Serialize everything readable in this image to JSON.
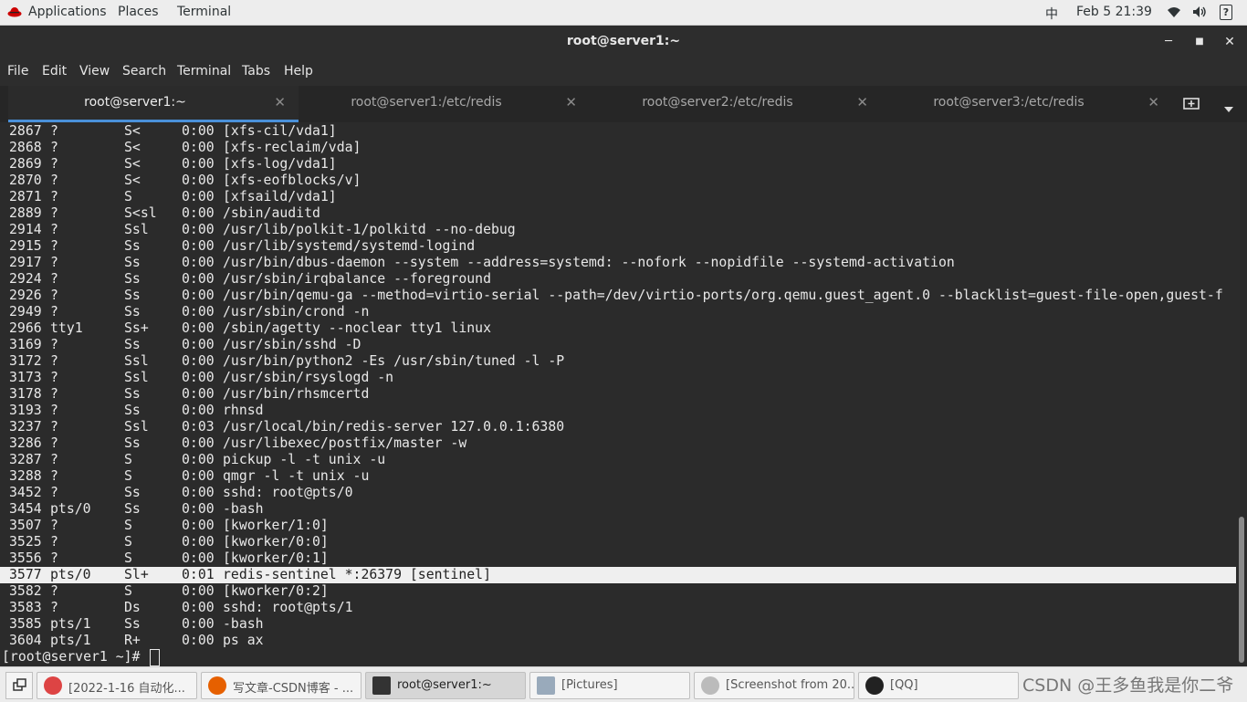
{
  "top_panel": {
    "applications": "Applications",
    "places": "Places",
    "terminal": "Terminal",
    "input_method": "中",
    "datetime": "Feb 5  21:39",
    "icons": [
      "redhat-logo-icon",
      "wifi-icon",
      "volume-icon",
      "help-icon"
    ]
  },
  "window": {
    "title": "root@server1:~"
  },
  "menu": [
    "File",
    "Edit",
    "View",
    "Search",
    "Terminal",
    "Tabs",
    "Help"
  ],
  "tabs": [
    {
      "label": "root@server1:~",
      "active": true
    },
    {
      "label": "root@server1:/etc/redis",
      "active": false
    },
    {
      "label": "root@server2:/etc/redis",
      "active": false
    },
    {
      "label": "root@server3:/etc/redis",
      "active": false
    }
  ],
  "processes": [
    {
      "pid": "2867",
      "tty": "?",
      "stat": "S<",
      "time": "0:00",
      "cmd": "[xfs-cil/vda1]"
    },
    {
      "pid": "2868",
      "tty": "?",
      "stat": "S<",
      "time": "0:00",
      "cmd": "[xfs-reclaim/vda]"
    },
    {
      "pid": "2869",
      "tty": "?",
      "stat": "S<",
      "time": "0:00",
      "cmd": "[xfs-log/vda1]"
    },
    {
      "pid": "2870",
      "tty": "?",
      "stat": "S<",
      "time": "0:00",
      "cmd": "[xfs-eofblocks/v]"
    },
    {
      "pid": "2871",
      "tty": "?",
      "stat": "S",
      "time": "0:00",
      "cmd": "[xfsaild/vda1]"
    },
    {
      "pid": "2889",
      "tty": "?",
      "stat": "S<sl",
      "time": "0:00",
      "cmd": "/sbin/auditd"
    },
    {
      "pid": "2914",
      "tty": "?",
      "stat": "Ssl",
      "time": "0:00",
      "cmd": "/usr/lib/polkit-1/polkitd --no-debug"
    },
    {
      "pid": "2915",
      "tty": "?",
      "stat": "Ss",
      "time": "0:00",
      "cmd": "/usr/lib/systemd/systemd-logind"
    },
    {
      "pid": "2917",
      "tty": "?",
      "stat": "Ss",
      "time": "0:00",
      "cmd": "/usr/bin/dbus-daemon --system --address=systemd: --nofork --nopidfile --systemd-activation"
    },
    {
      "pid": "2924",
      "tty": "?",
      "stat": "Ss",
      "time": "0:00",
      "cmd": "/usr/sbin/irqbalance --foreground"
    },
    {
      "pid": "2926",
      "tty": "?",
      "stat": "Ss",
      "time": "0:00",
      "cmd": "/usr/bin/qemu-ga --method=virtio-serial --path=/dev/virtio-ports/org.qemu.guest_agent.0 --blacklist=guest-file-open,guest-f"
    },
    {
      "pid": "2949",
      "tty": "?",
      "stat": "Ss",
      "time": "0:00",
      "cmd": "/usr/sbin/crond -n"
    },
    {
      "pid": "2966",
      "tty": "tty1",
      "stat": "Ss+",
      "time": "0:00",
      "cmd": "/sbin/agetty --noclear tty1 linux"
    },
    {
      "pid": "3169",
      "tty": "?",
      "stat": "Ss",
      "time": "0:00",
      "cmd": "/usr/sbin/sshd -D"
    },
    {
      "pid": "3172",
      "tty": "?",
      "stat": "Ssl",
      "time": "0:00",
      "cmd": "/usr/bin/python2 -Es /usr/sbin/tuned -l -P"
    },
    {
      "pid": "3173",
      "tty": "?",
      "stat": "Ssl",
      "time": "0:00",
      "cmd": "/usr/sbin/rsyslogd -n"
    },
    {
      "pid": "3178",
      "tty": "?",
      "stat": "Ss",
      "time": "0:00",
      "cmd": "/usr/bin/rhsmcertd"
    },
    {
      "pid": "3193",
      "tty": "?",
      "stat": "Ss",
      "time": "0:00",
      "cmd": "rhnsd"
    },
    {
      "pid": "3237",
      "tty": "?",
      "stat": "Ssl",
      "time": "0:03",
      "cmd": "/usr/local/bin/redis-server 127.0.0.1:6380"
    },
    {
      "pid": "3286",
      "tty": "?",
      "stat": "Ss",
      "time": "0:00",
      "cmd": "/usr/libexec/postfix/master -w"
    },
    {
      "pid": "3287",
      "tty": "?",
      "stat": "S",
      "time": "0:00",
      "cmd": "pickup -l -t unix -u"
    },
    {
      "pid": "3288",
      "tty": "?",
      "stat": "S",
      "time": "0:00",
      "cmd": "qmgr -l -t unix -u"
    },
    {
      "pid": "3452",
      "tty": "?",
      "stat": "Ss",
      "time": "0:00",
      "cmd": "sshd: root@pts/0"
    },
    {
      "pid": "3454",
      "tty": "pts/0",
      "stat": "Ss",
      "time": "0:00",
      "cmd": "-bash"
    },
    {
      "pid": "3507",
      "tty": "?",
      "stat": "S",
      "time": "0:00",
      "cmd": "[kworker/1:0]"
    },
    {
      "pid": "3525",
      "tty": "?",
      "stat": "S",
      "time": "0:00",
      "cmd": "[kworker/0:0]"
    },
    {
      "pid": "3556",
      "tty": "?",
      "stat": "S",
      "time": "0:00",
      "cmd": "[kworker/0:1]"
    },
    {
      "pid": "3577",
      "tty": "pts/0",
      "stat": "Sl+",
      "time": "0:01",
      "cmd": "redis-sentinel *:26379 [sentinel]",
      "highlight": true
    },
    {
      "pid": "3582",
      "tty": "?",
      "stat": "S",
      "time": "0:00",
      "cmd": "[kworker/0:2]"
    },
    {
      "pid": "3583",
      "tty": "?",
      "stat": "Ds",
      "time": "0:00",
      "cmd": "sshd: root@pts/1"
    },
    {
      "pid": "3585",
      "tty": "pts/1",
      "stat": "Ss",
      "time": "0:00",
      "cmd": "-bash"
    },
    {
      "pid": "3604",
      "tty": "pts/1",
      "stat": "R+",
      "time": "0:00",
      "cmd": "ps ax"
    }
  ],
  "prompt": "[root@server1 ~]# ",
  "taskbar": [
    {
      "label": "[2022-1-16 自动化...",
      "icon": "chrome-icon",
      "color": "#d44"
    },
    {
      "label": "写文章-CSDN博客 - ...",
      "icon": "firefox-icon",
      "color": "#e66000"
    },
    {
      "label": "root@server1:~",
      "icon": "terminal-icon",
      "color": "#333",
      "active": true
    },
    {
      "label": "[Pictures]",
      "icon": "file-manager-icon",
      "color": "#9ab"
    },
    {
      "label": "[Screenshot from 20...",
      "icon": "image-viewer-icon",
      "color": "#bbb"
    },
    {
      "label": "[QQ]",
      "icon": "qq-icon",
      "color": "#222"
    }
  ],
  "watermark": "CSDN @王多鱼我是你二爷"
}
